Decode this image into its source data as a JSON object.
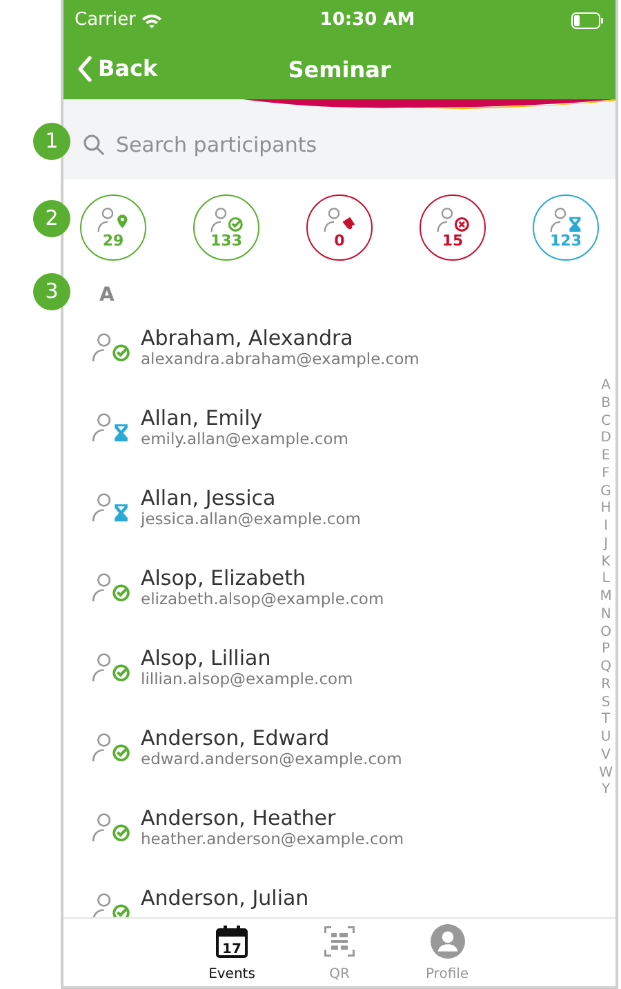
{
  "callouts": [
    "1",
    "2",
    "3"
  ],
  "status_bar": {
    "carrier": "Carrier",
    "time": "10:30 AM"
  },
  "nav": {
    "back": "Back",
    "title": "Seminar"
  },
  "search": {
    "placeholder": "Search participants"
  },
  "filters": [
    {
      "kind": "location",
      "count": "29",
      "color": "#5aaf32"
    },
    {
      "kind": "checked",
      "count": "133",
      "color": "#5aaf32"
    },
    {
      "kind": "bell",
      "count": "0",
      "color": "#c8102e"
    },
    {
      "kind": "declined",
      "count": "15",
      "color": "#c8102e"
    },
    {
      "kind": "waiting",
      "count": "123",
      "color": "#29a9d6"
    }
  ],
  "section": "A",
  "participants": [
    {
      "name": "Abraham, Alexandra",
      "email": "alexandra.abraham@example.com",
      "kind": "checked"
    },
    {
      "name": "Allan, Emily",
      "email": "emily.allan@example.com",
      "kind": "waiting"
    },
    {
      "name": "Allan, Jessica",
      "email": "jessica.allan@example.com",
      "kind": "waiting"
    },
    {
      "name": "Alsop, Elizabeth",
      "email": "elizabeth.alsop@example.com",
      "kind": "checked"
    },
    {
      "name": "Alsop, Lillian",
      "email": "lillian.alsop@example.com",
      "kind": "checked"
    },
    {
      "name": "Anderson, Edward",
      "email": "edward.anderson@example.com",
      "kind": "checked"
    },
    {
      "name": "Anderson, Heather",
      "email": "heather.anderson@example.com",
      "kind": "checked"
    },
    {
      "name": "Anderson, Julian",
      "kind": "checked"
    }
  ],
  "index": [
    "A",
    "B",
    "C",
    "D",
    "E",
    "F",
    "G",
    "H",
    "I",
    "J",
    "K",
    "L",
    "M",
    "N",
    "O",
    "P",
    "Q",
    "R",
    "S",
    "T",
    "U",
    "V",
    "W",
    "Y"
  ],
  "tabs": [
    {
      "label": "Events",
      "kind": "calendar",
      "icon_text": "17",
      "selected": true
    },
    {
      "label": "QR",
      "kind": "qr",
      "selected": false
    },
    {
      "label": "Profile",
      "kind": "profile",
      "selected": false
    }
  ]
}
